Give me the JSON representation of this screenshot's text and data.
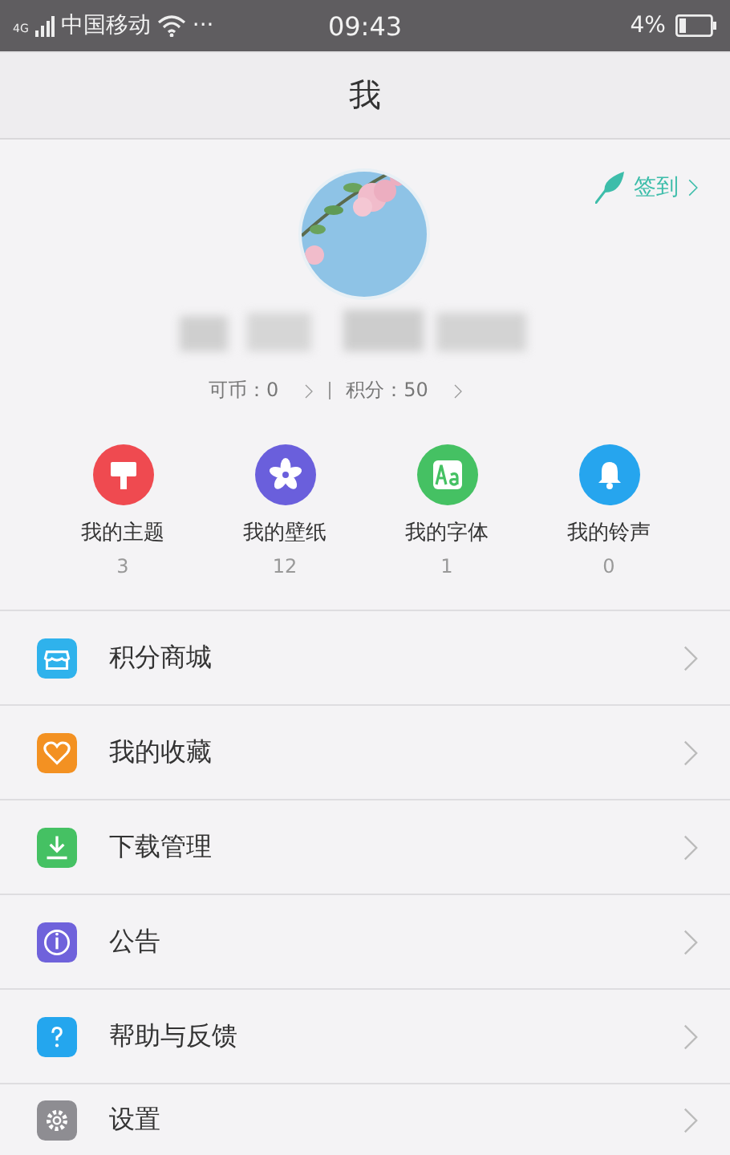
{
  "status_bar": {
    "network": "4G",
    "carrier": "中国移动",
    "more": "···",
    "time": "09:43",
    "battery": "4%"
  },
  "header": {
    "title": "我"
  },
  "profile": {
    "checkin": "签到",
    "stats": [
      {
        "label": "可币：",
        "value": "0"
      },
      {
        "label": "积分：",
        "value": "50"
      }
    ]
  },
  "shortcuts": [
    {
      "kind": "theme",
      "label": "我的主题",
      "count": "3",
      "color": "#ef4a50"
    },
    {
      "kind": "wallpaper",
      "label": "我的壁纸",
      "count": "12",
      "color": "#6a5fdc"
    },
    {
      "kind": "font",
      "label": "我的字体",
      "count": "1",
      "color": "#45c163"
    },
    {
      "kind": "ringtone",
      "label": "我的铃声",
      "count": "0",
      "color": "#26a5ee"
    }
  ],
  "menu": [
    {
      "kind": "store",
      "label": "积分商城",
      "color": "#2fb2ec"
    },
    {
      "kind": "favorites",
      "label": "我的收藏",
      "color": "#f39122"
    },
    {
      "kind": "download",
      "label": "下载管理",
      "color": "#45c163"
    },
    {
      "kind": "notice",
      "label": "公告",
      "color": "#6f62db"
    },
    {
      "kind": "help",
      "label": "帮助与反馈",
      "color": "#24a6ee"
    },
    {
      "kind": "settings",
      "label": "设置",
      "color": "#8e8d92"
    }
  ]
}
